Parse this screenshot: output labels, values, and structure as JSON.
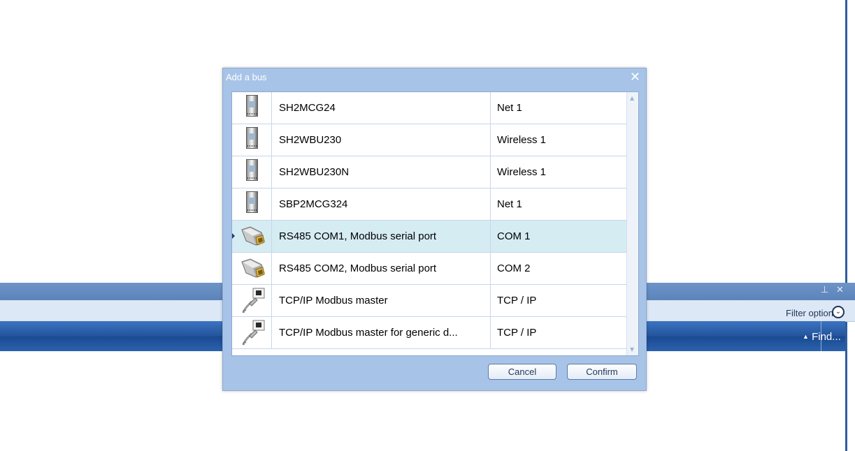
{
  "dialog": {
    "title": "Add a bus",
    "close_icon": "close-icon",
    "cancel_label": "Cancel",
    "confirm_label": "Confirm"
  },
  "bus_list": {
    "rows": [
      {
        "name": "SH2MCG24",
        "type": "Net 1",
        "icon": "module-icon"
      },
      {
        "name": "SH2WBU230",
        "type": "Wireless 1",
        "icon": "module-icon"
      },
      {
        "name": "SH2WBU230N",
        "type": "Wireless 1",
        "icon": "module-icon"
      },
      {
        "name": "SBP2MCG324",
        "type": "Net 1",
        "icon": "module-icon"
      },
      {
        "name": "RS485 COM1, Modbus serial port",
        "type": "COM 1",
        "icon": "serial-port-icon",
        "selected": true
      },
      {
        "name": "RS485 COM2, Modbus serial port",
        "type": "COM 2",
        "icon": "serial-port-icon"
      },
      {
        "name": "TCP/IP Modbus master",
        "type": "TCP / IP",
        "icon": "network-cable-icon"
      },
      {
        "name": "TCP/IP Modbus master for generic d...",
        "type": "TCP / IP",
        "icon": "network-cable-icon"
      }
    ]
  },
  "background_panel": {
    "pin_glyph": "⊥",
    "close_glyph": "✕",
    "filter_label": "Filter options",
    "find_label": "Find..."
  },
  "colors": {
    "dialog_bg": "#a7c4e8",
    "selected_row": "#d6ecf3",
    "panel_blue": "#25559e"
  }
}
